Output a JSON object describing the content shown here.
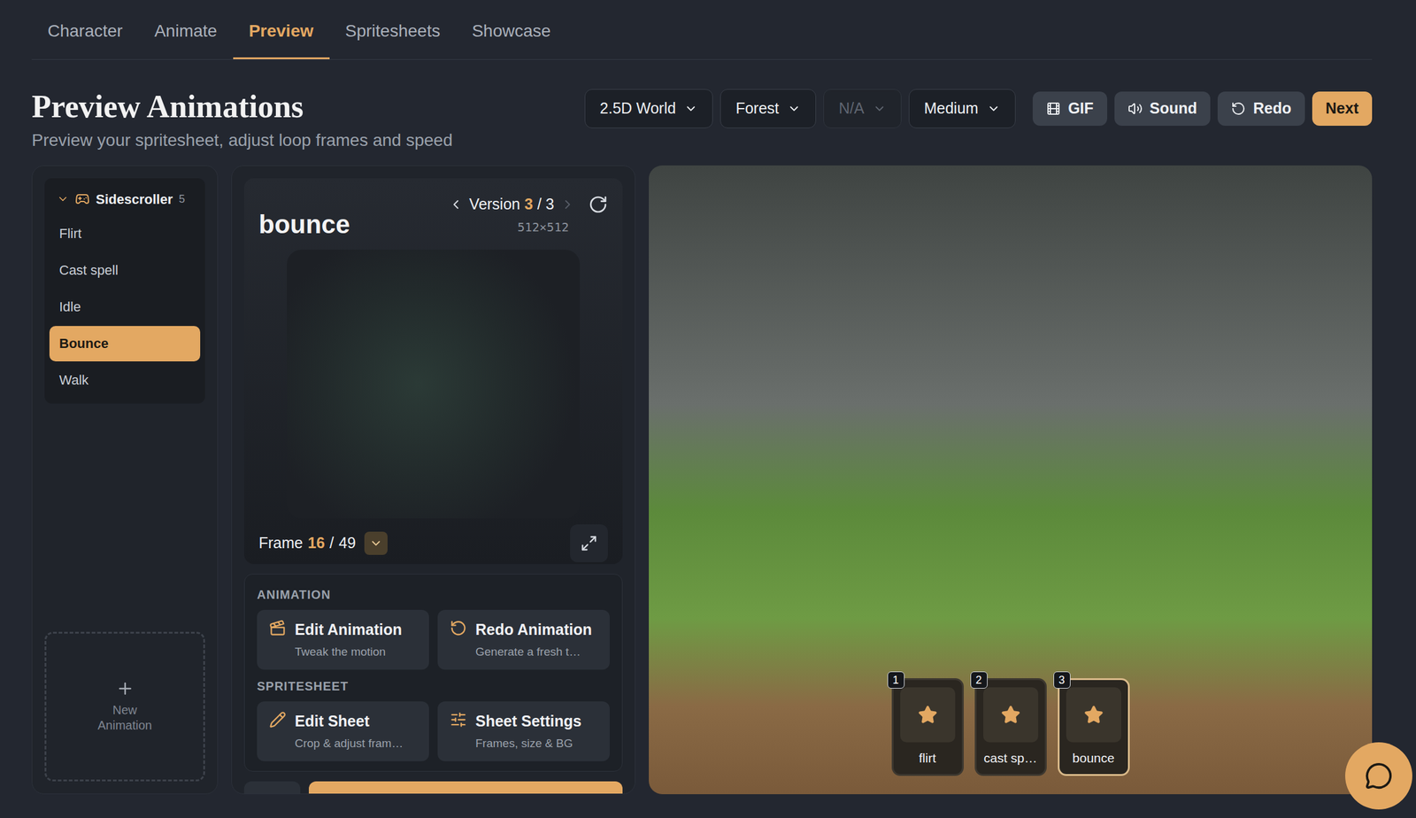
{
  "tabs": [
    {
      "label": "Character",
      "selected": false
    },
    {
      "label": "Animate",
      "selected": false
    },
    {
      "label": "Preview",
      "selected": true
    },
    {
      "label": "Spritesheets",
      "selected": false
    },
    {
      "label": "Showcase",
      "selected": false
    }
  ],
  "header": {
    "title": "Preview Animations",
    "subtitle": "Preview your spritesheet, adjust loop frames and speed"
  },
  "dropdowns": [
    {
      "label": "2.5D World",
      "disabled": false
    },
    {
      "label": "Forest",
      "disabled": false
    },
    {
      "label": "N/A",
      "disabled": true
    },
    {
      "label": "Medium",
      "disabled": false
    }
  ],
  "buttons": [
    {
      "label": "GIF",
      "kind": "secondary"
    },
    {
      "label": "Sound",
      "kind": "secondary"
    },
    {
      "label": "Redo",
      "kind": "secondary"
    },
    {
      "label": "Next",
      "kind": "primary"
    }
  ],
  "sidebar": {
    "group": {
      "label": "Sidescroller",
      "count": "5",
      "expanded": true
    },
    "items": [
      {
        "label": "Flirt",
        "selected": false
      },
      {
        "label": "Cast spell",
        "selected": false
      },
      {
        "label": "Idle",
        "selected": false
      },
      {
        "label": "Bounce",
        "selected": true
      },
      {
        "label": "Walk",
        "selected": false
      }
    ],
    "new_animation": "New Animation"
  },
  "preview": {
    "name": "bounce",
    "version": {
      "label": "Version",
      "current": "3",
      "separator": "/",
      "total": "3",
      "prev_disabled": false,
      "next_disabled": true
    },
    "resolution": "512×512",
    "frame": {
      "label": "Frame",
      "current": "16",
      "separator": "/",
      "total": "49"
    }
  },
  "actions": [
    {
      "title": "ANIMATION",
      "items": [
        {
          "title": "Edit Animation",
          "subtitle": "Tweak the motion"
        },
        {
          "title": "Redo Animation",
          "subtitle": "Generate a fresh t…"
        }
      ]
    },
    {
      "title": "SPRITESHEET",
      "items": [
        {
          "title": "Edit Sheet",
          "subtitle": "Crop & adjust fram…"
        },
        {
          "title": "Sheet Settings",
          "subtitle": "Frames, size & BG"
        }
      ]
    }
  ],
  "scene": {
    "slots": [
      {
        "number": "1",
        "label": "flirt",
        "selected": false
      },
      {
        "number": "2",
        "label": "cast sp…",
        "selected": false
      },
      {
        "number": "3",
        "label": "bounce",
        "selected": true
      }
    ]
  }
}
